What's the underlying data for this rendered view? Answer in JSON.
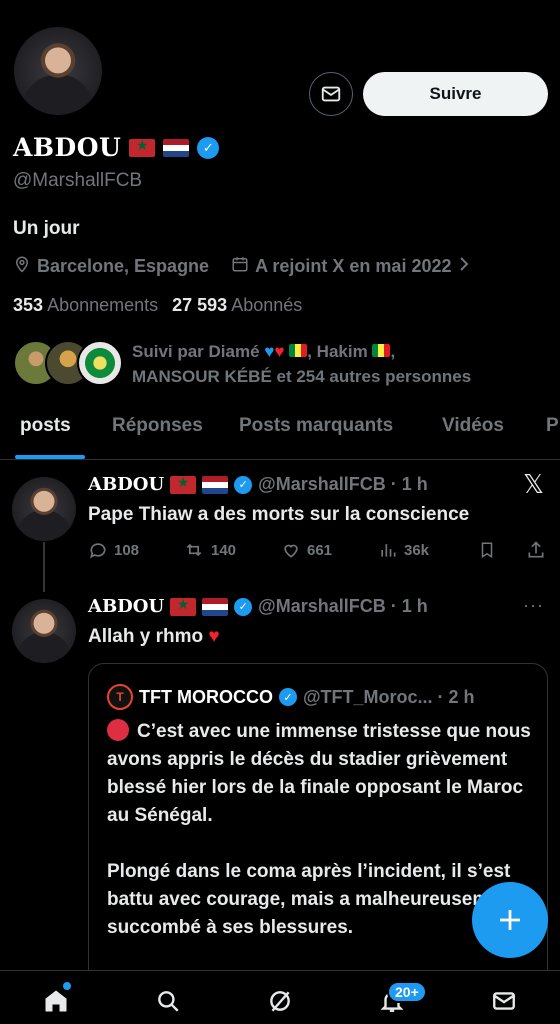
{
  "profile": {
    "display_name": "ABDOU",
    "handle": "@MarshallFCB",
    "bio": "Un jour",
    "location": "Barcelone, Espagne",
    "joined": "A rejoint X en mai 2022",
    "following_count": "353",
    "following_label": "Abonnements",
    "followers_count": "27 593",
    "followers_label": "Abonnés",
    "followed_by": {
      "prefix": "Suivi par Diamé",
      "middle": ", Hakim",
      "suffix": ",",
      "line2": "MANSOUR KÉBÉ et 254 autres personnes"
    },
    "follow_button": "Suivre"
  },
  "tabs": [
    {
      "label": "posts",
      "active": true
    },
    {
      "label": "Réponses"
    },
    {
      "label": "Posts marquants"
    },
    {
      "label": "Vidéos"
    },
    {
      "label": "P"
    }
  ],
  "tweets": [
    {
      "name": "ABDOU",
      "meta": "@MarshallFCB · 1 h",
      "text": "Pape Thiaw a des morts sur la conscience",
      "replies": "108",
      "reposts": "140",
      "likes": "661",
      "views": "36k"
    },
    {
      "name": "ABDOU",
      "meta": "@MarshallFCB · 1 h",
      "text": "Allah y rhmo",
      "quote": {
        "name": "TFT MOROCCO",
        "meta": "@TFT_Moroc... · 2 h",
        "para1": "C’est avec une immense tristesse que nous avons appris le décès du stadier grièvement blessé hier lors de la finale opposant le Maroc au Sénégal.",
        "para2": "Plongé dans le coma après l’incident, il s’est battu avec courage, mais a malheureusement succombé à ses blessures."
      }
    }
  ],
  "nav": {
    "notifications_badge": "20+"
  },
  "colors": {
    "accent": "#1d9bf0",
    "background": "#000000",
    "text_secondary": "#71767b"
  }
}
